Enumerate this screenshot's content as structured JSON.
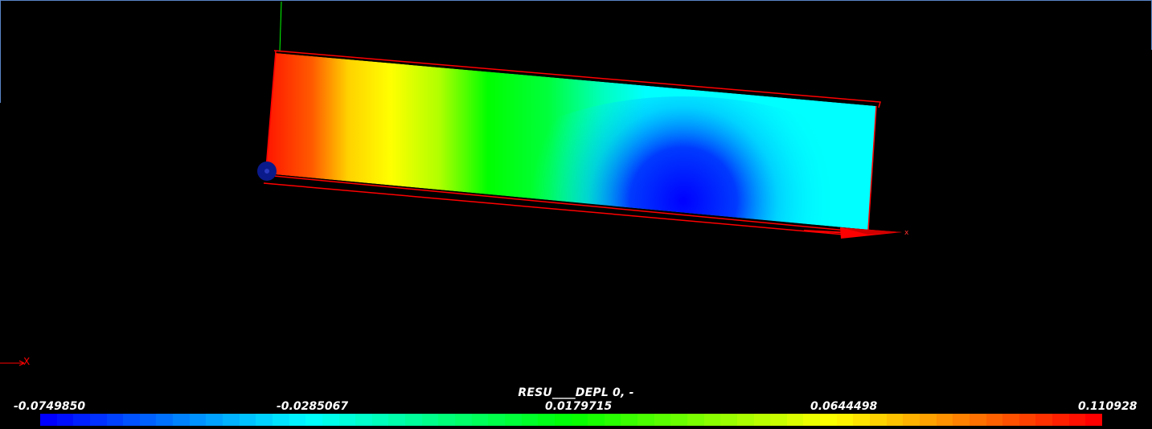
{
  "scalar_bar": {
    "title": "RESU____DEPL 0, -",
    "ticks": [
      "-0.0749850",
      "-0.0285067",
      "0.0179715",
      "0.0644498",
      "0.110928"
    ],
    "segments": 64,
    "colormap_stops": [
      "#0000ff",
      "#00ffff",
      "#00ff00",
      "#ffff00",
      "#ff0000"
    ]
  },
  "axes": {
    "main_x_label": "x",
    "corner_x_label": "X",
    "x_axis_color": "#ff0000",
    "y_axis_color": "#00ff00",
    "z_axis_color": "#0a1a8a"
  },
  "frame_color": "#5a86c8",
  "background_color": "#000000"
}
